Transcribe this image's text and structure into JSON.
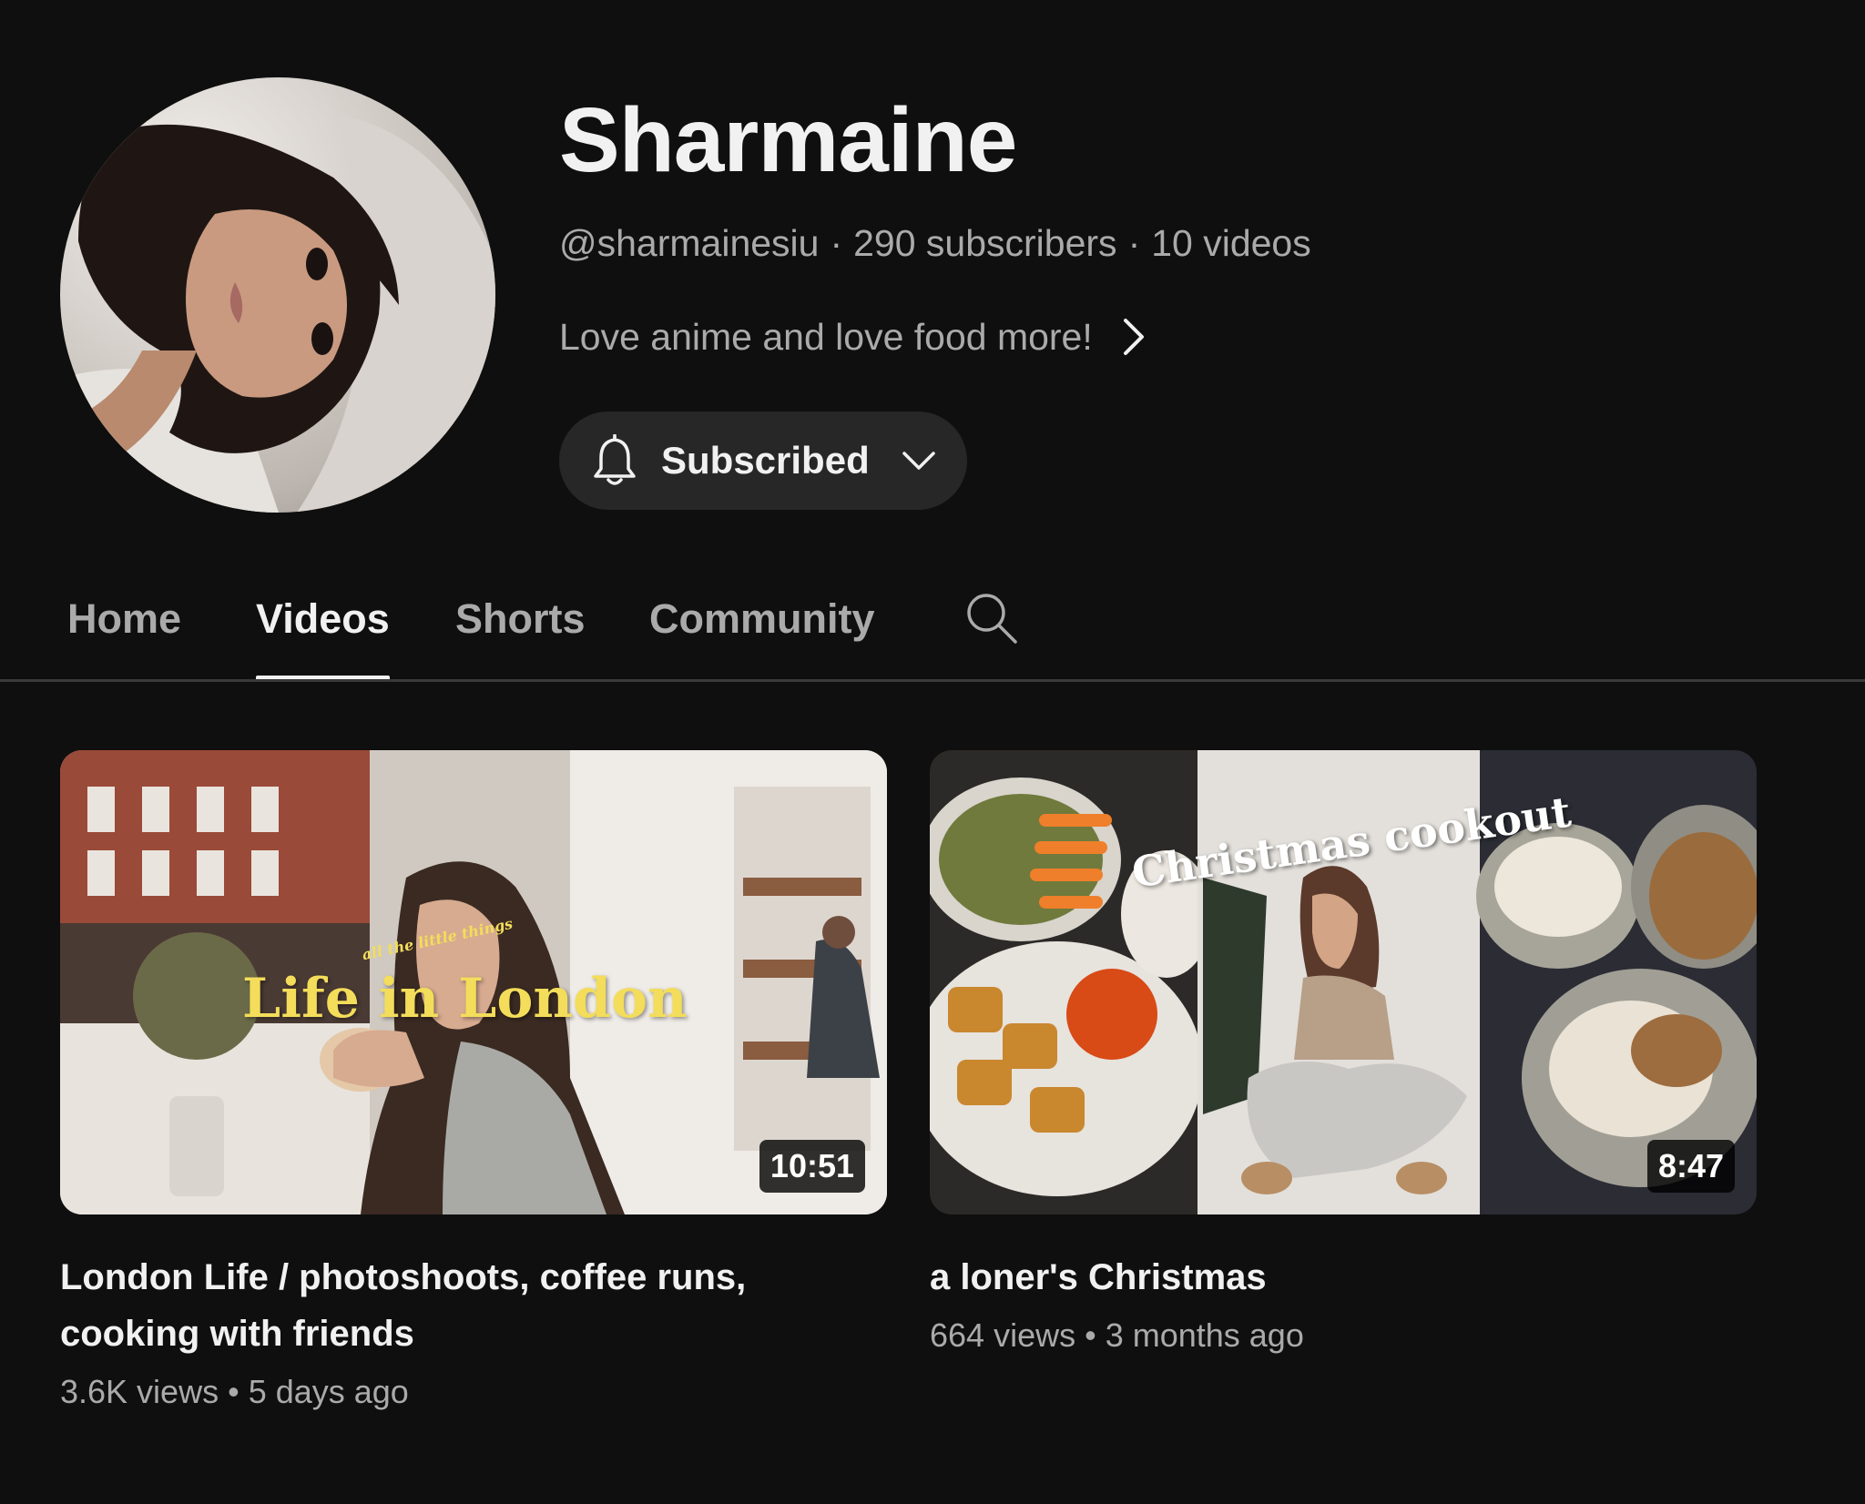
{
  "channel": {
    "name": "Sharmaine",
    "handle": "@sharmainesiu",
    "subscribers": "290 subscribers",
    "video_count": "10 videos",
    "description": "Love anime and love food more!",
    "subscribe_label": "Subscribed",
    "icons": {
      "bell": "bell-icon",
      "chevron": "chevron-down-icon",
      "more": "chevron-right-icon"
    }
  },
  "tabs": [
    {
      "label": "Home",
      "active": false
    },
    {
      "label": "Videos",
      "active": true
    },
    {
      "label": "Shorts",
      "active": false
    },
    {
      "label": "Community",
      "active": false
    }
  ],
  "videos": [
    {
      "title": "London Life / photoshoots, coffee runs, cooking with friends",
      "views": "3.6K views",
      "age": "5 days ago",
      "duration": "10:51",
      "thumbnail_text": "Life in London",
      "thumbnail_subtext": "all the little things"
    },
    {
      "title": "a loner's Christmas",
      "views": "664 views",
      "age": "3 months ago",
      "duration": "8:47",
      "thumbnail_text": "Christmas cookout"
    }
  ],
  "colors": {
    "background": "#0f0f0f",
    "primary_text": "#f1f1f1",
    "secondary_text": "#aaaaaa",
    "button_bg": "#272727",
    "divider": "#3a3a3a"
  }
}
